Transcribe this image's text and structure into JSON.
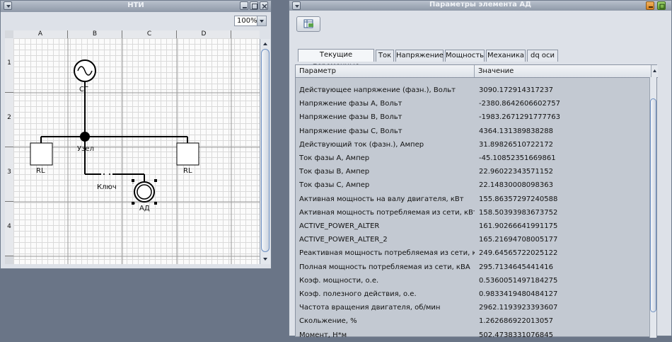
{
  "left_window": {
    "title": "НТИ",
    "zoom": "100%",
    "columns": [
      "A",
      "B",
      "C",
      "D"
    ],
    "rows": [
      "1",
      "2",
      "3",
      "4"
    ],
    "elements": {
      "generator_label": "СГ",
      "node_label": "Узел",
      "load_left_label": "RL",
      "load_right_label": "RL",
      "switch_label": "Ключ",
      "motor_label": "АД"
    }
  },
  "right_window": {
    "title": "Параметры элемента АД",
    "tabs": [
      "Текущие переменные",
      "Ток",
      "Напряжение",
      "Мощность",
      "Механика",
      "dq оси"
    ],
    "active_tab": "Текущие переменные",
    "table": {
      "columns": [
        "Параметр",
        "Значение"
      ],
      "rows": [
        {
          "param": "Действующее напряжение (фазн.), Вольт",
          "value": "3090.172914317237"
        },
        {
          "param": "Напряжение фазы А, Вольт",
          "value": "-2380.8642606602757"
        },
        {
          "param": "Напряжение фазы В, Вольт",
          "value": "-1983.2671291777763"
        },
        {
          "param": "Напряжение фазы С, Вольт",
          "value": "4364.131389838288"
        },
        {
          "param": "Действующий ток (фазн.), Ампер",
          "value": "31.89826510722172"
        },
        {
          "param": "Ток фазы А, Ампер",
          "value": "-45.10852351669861"
        },
        {
          "param": "Ток фазы В, Ампер",
          "value": "22.96022343571152"
        },
        {
          "param": "Ток фазы С, Ампер",
          "value": "22.14830008098363"
        },
        {
          "param": "Активная мощность на валу двигателя, кВт",
          "value": "155.86357297240588"
        },
        {
          "param": "Активная мощность потребляемая из сети, кВт",
          "value": "158.50393983673752"
        },
        {
          "param": "ACTIVE_POWER_ALTER",
          "value": "161.90266641991175"
        },
        {
          "param": "ACTIVE_POWER_ALTER_2",
          "value": "165.21694708005177"
        },
        {
          "param": "Реактивная мощность потребляемая из сети, кВАР",
          "value": "249.64565722025122"
        },
        {
          "param": "Полная мощность потребляемая из сети, кВА",
          "value": "295.7134645441416"
        },
        {
          "param": "Коэф. мощности, о.е.",
          "value": "0.5360051497184275"
        },
        {
          "param": "Коэф. полезного действия, о.е.",
          "value": "0.9833419480484127"
        },
        {
          "param": "Частота вращения двигателя, об/мин",
          "value": "2962.1193923393607"
        },
        {
          "param": "Скольжение, %",
          "value": "1.262686922013057"
        },
        {
          "param": "Момент, Н*м",
          "value": "502.4738331076845"
        }
      ]
    }
  },
  "colors": {
    "desktop": "#6a7587",
    "titlebar": "#9aa3b1",
    "close_button": "#e7962f",
    "maximize_button": "#78b844"
  }
}
